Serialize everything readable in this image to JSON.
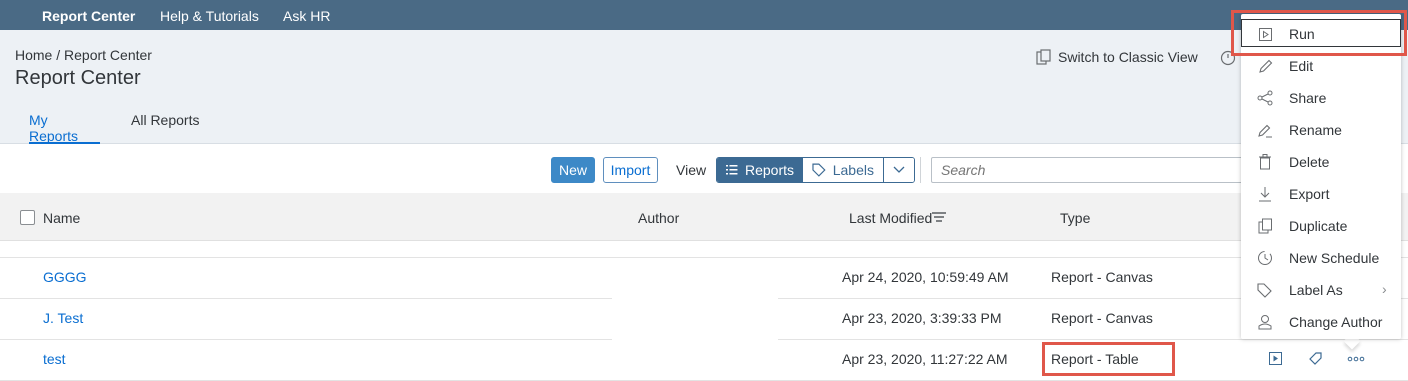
{
  "topbar": {
    "items": [
      "Report Center",
      "Help & Tutorials",
      "Ask HR"
    ]
  },
  "header": {
    "breadcrumb": "Home / Report Center",
    "title": "Report Center",
    "switch_classic": "Switch to Classic View",
    "tabs": [
      "My Reports",
      "All Reports"
    ]
  },
  "toolbar": {
    "new_label": "New",
    "import_label": "Import",
    "view_label": "View",
    "reports_label": "Reports",
    "labels_label": "Labels",
    "search_placeholder": "Search"
  },
  "table": {
    "columns": [
      "Name",
      "Author",
      "Last Modified",
      "Type"
    ],
    "rows": [
      {
        "name": "GGGG",
        "modified": "Apr 24, 2020, 10:59:49 AM",
        "type": "Report - Canvas"
      },
      {
        "name": "J. Test",
        "modified": "Apr 23, 2020, 3:39:33 PM",
        "type": "Report - Canvas"
      },
      {
        "name": "test",
        "modified": "Apr 23, 2020, 11:27:22 AM",
        "type": "Report - Table"
      }
    ]
  },
  "context_menu": {
    "items": [
      "Run",
      "Edit",
      "Share",
      "Rename",
      "Delete",
      "Export",
      "Duplicate",
      "New Schedule",
      "Label As",
      "Change Author"
    ],
    "icons": [
      "play-icon",
      "pencil-icon",
      "share-icon",
      "rename-icon",
      "trash-icon",
      "download-icon",
      "duplicate-icon",
      "schedule-icon",
      "tag-icon",
      "person-icon"
    ]
  },
  "colors": {
    "topbar": "#4a6a85",
    "link": "#0a6ed1",
    "highlight": "#e0574a",
    "accent": "#3c6a93"
  }
}
